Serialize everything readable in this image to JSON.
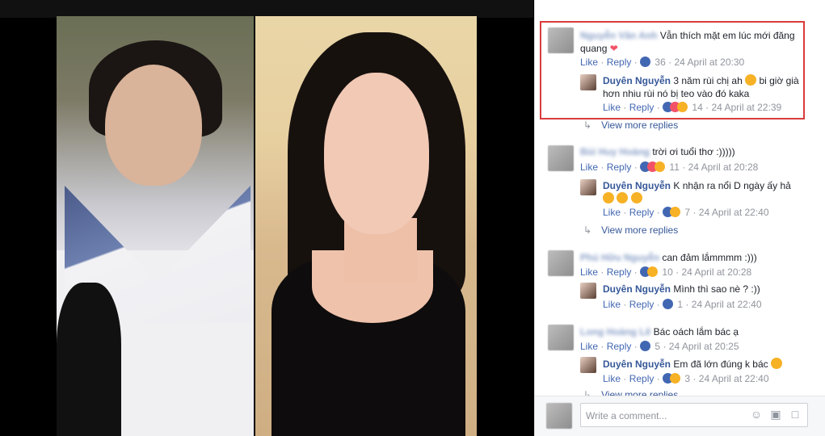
{
  "comments": [
    {
      "author": "Nguyễn Văn Anh",
      "text": "Vẫn thích mặt em lúc mới đăng quang",
      "like": "Like",
      "reply": "Reply",
      "count": "36",
      "time": "24 April at 20:30",
      "replies": [
        {
          "author": "Duyên Nguyễn",
          "text": "3 năm rùi chị ah",
          "text2": "bi giờ già hơn nhiu rùi nó bị teo vào đó kaka",
          "like": "Like",
          "reply": "Reply",
          "count": "14",
          "time": "24 April at 22:39"
        }
      ],
      "view_more": "View more replies"
    },
    {
      "author": "Bùi Huy Hoàng",
      "text": "trời ơi tuổi thơ :)))))",
      "like": "Like",
      "reply": "Reply",
      "count": "11",
      "time": "24 April at 20:28",
      "replies": [
        {
          "author": "Duyên Nguyễn",
          "text": "K nhận ra nổi D ngày ấy hả",
          "like": "Like",
          "reply": "Reply",
          "count": "7",
          "time": "24 April at 22:40"
        }
      ],
      "view_more": "View more replies"
    },
    {
      "author": "Phú Hữu Nguyễn",
      "text": "can đảm lắmmmm :)))",
      "like": "Like",
      "reply": "Reply",
      "count": "10",
      "time": "24 April at 20:28",
      "replies": [
        {
          "author": "Duyên Nguyễn",
          "text": "Mình thì sao nè ? :))",
          "like": "Like",
          "reply": "Reply",
          "count": "1",
          "time": "24 April at 22:40"
        }
      ]
    },
    {
      "author": "Long Hoàng Lê",
      "text": "Bác oách lắm bác ạ",
      "like": "Like",
      "reply": "Reply",
      "count": "5",
      "time": "24 April at 20:25",
      "replies": [
        {
          "author": "Duyên Nguyễn",
          "text": "Em đã lớn đúng k bác",
          "like": "Like",
          "reply": "Reply",
          "count": "3",
          "time": "24 April at 22:40"
        }
      ],
      "view_more": "View more replies"
    }
  ],
  "separator": "·",
  "composer": {
    "placeholder": "Write a comment..."
  },
  "icons": {
    "emoji": "smiley-icon",
    "camera": "camera-icon",
    "sticker": "sticker-icon"
  }
}
